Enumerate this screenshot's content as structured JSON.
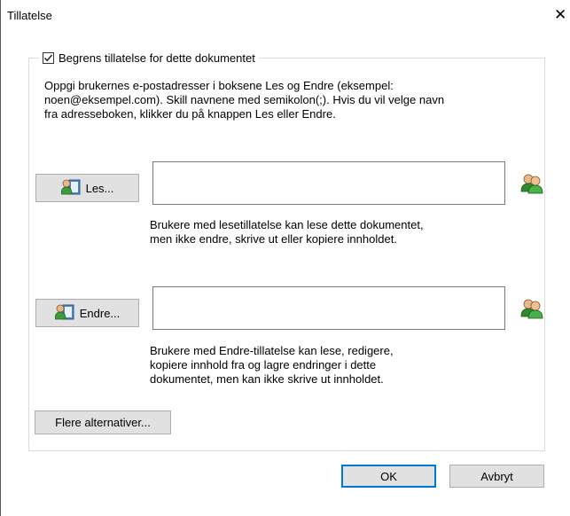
{
  "window": {
    "title": "Tillatelse",
    "close_glyph": "✕"
  },
  "restrict": {
    "label": "Begrens tillatelse for dette dokumentet",
    "checked": true
  },
  "instructions": [
    "Oppgi brukernes e-postadresser i boksene Les og Endre (eksempel:",
    "noen@eksempel.com). Skill navnene med semikolon(;). Hvis du vil velge navn",
    "fra adresseboken, klikker du på knappen Les eller Endre."
  ],
  "read": {
    "button_label": "Les...",
    "value": "",
    "description": [
      "Brukere med lesetillatelse kan lese dette dokumentet,",
      "men ikke endre, skrive ut eller kopiere innholdet."
    ]
  },
  "change": {
    "button_label": "Endre...",
    "value": "",
    "description": [
      "Brukere med Endre-tillatelse kan lese, redigere,",
      "kopiere innhold fra og lagre endringer i dette",
      "dokumentet, men kan ikke skrive ut innholdet."
    ]
  },
  "more_options_label": "Flere alternativer...",
  "footer": {
    "ok_label": "OK",
    "cancel_label": "Avbryt"
  },
  "icons": {
    "address_book": "address-book-icon",
    "user_lookup": "user-lookup-icon"
  }
}
